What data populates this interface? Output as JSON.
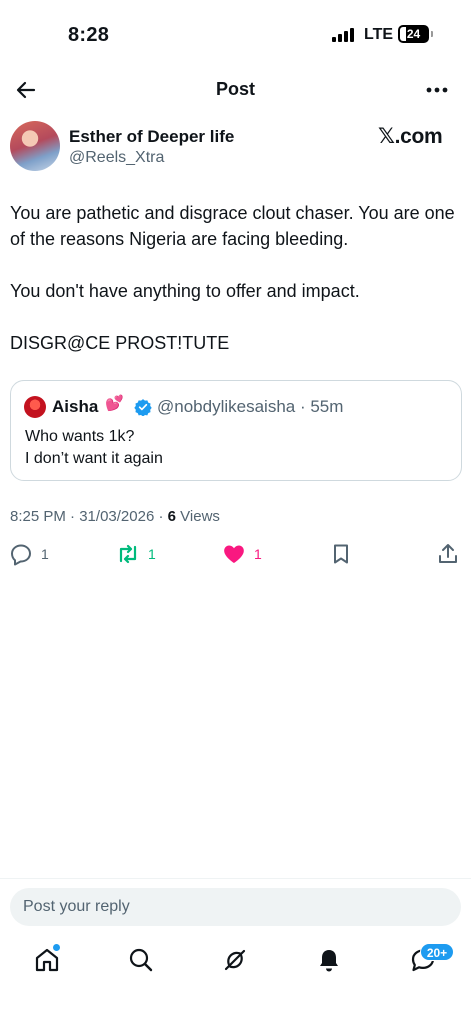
{
  "status_bar": {
    "time": "8:28",
    "network": "LTE",
    "battery": "24"
  },
  "header": {
    "title": "Post",
    "back_icon": "arrow-left-icon",
    "more_icon": "more-horizontal-icon"
  },
  "post": {
    "author_name": "Esther of Deeper life",
    "author_handle": "@Reels_Xtra",
    "brand": "𝕏.com",
    "paragraphs": [
      "You are pathetic and disgrace clout chaser. You are one of the reasons Nigeria are facing bleeding.",
      "You don't have anything to offer and impact.",
      "DISGR@CE PROST!TUTE"
    ],
    "time": "8:25 PM",
    "date": "31/03/2026",
    "views_count": "6",
    "views_label": "Views"
  },
  "quote": {
    "name": "Aisha",
    "emoji": "💕",
    "handle": "@nobdylikesaisha",
    "age": "55m",
    "lines": [
      "Who wants 1k?",
      "I don’t want it again"
    ]
  },
  "actions": {
    "reply_count": "1",
    "repost_count": "1",
    "like_count": "1"
  },
  "reply": {
    "placeholder": "Post your reply"
  },
  "tabs": {
    "messages_badge": "20+"
  },
  "colors": {
    "accent": "#1d9bf0",
    "repost": "#00ba7c",
    "like": "#f91880",
    "secondary_text": "#536471"
  }
}
